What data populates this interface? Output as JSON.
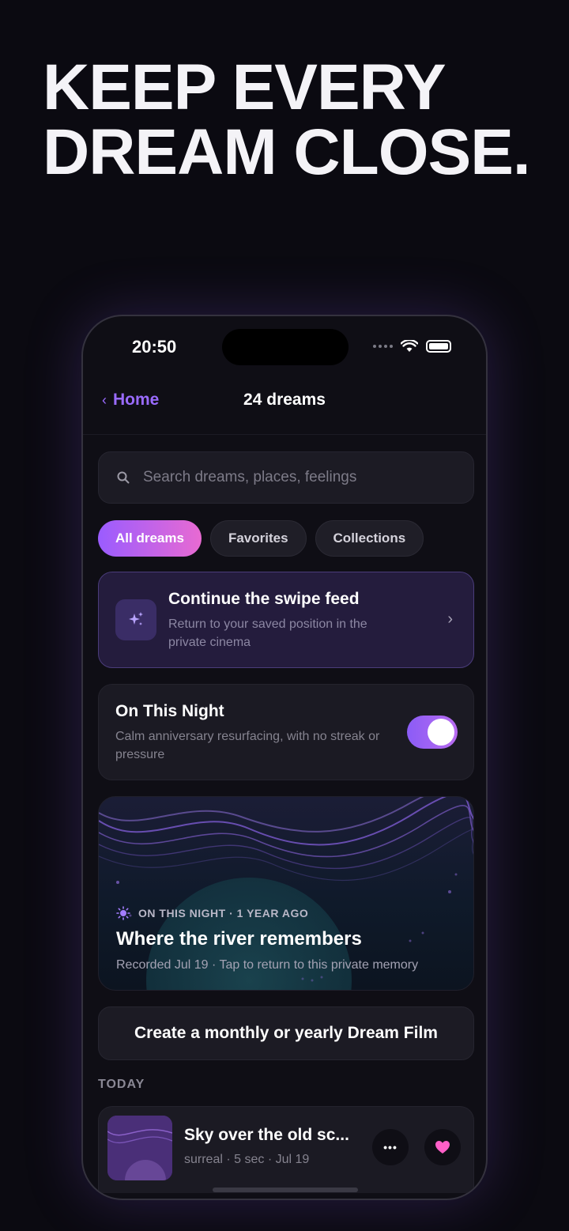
{
  "headline": {
    "line1": "KEEP EVERY",
    "line2": "DREAM CLOSE."
  },
  "status_bar": {
    "time": "20:50"
  },
  "navbar": {
    "back_label": "Home",
    "title": "24 dreams"
  },
  "search": {
    "placeholder": "Search dreams, places, feelings",
    "value": ""
  },
  "filters": [
    {
      "label": "All dreams",
      "active": true
    },
    {
      "label": "Favorites",
      "active": false
    },
    {
      "label": "Collections",
      "active": false
    }
  ],
  "continue_card": {
    "title": "Continue the swipe feed",
    "subtitle": "Return to your saved position in the private cinema"
  },
  "on_this_night": {
    "title": "On This Night",
    "subtitle": "Calm anniversary resurfacing, with no streak or pressure",
    "enabled": true
  },
  "memory_card": {
    "label": "ON THIS NIGHT · 1 YEAR AGO",
    "title": "Where the river remembers",
    "subtitle": "Recorded Jul 19 · Tap to return to this private memory"
  },
  "film_button": {
    "label": "Create a monthly or yearly Dream Film"
  },
  "today_section": {
    "heading": "TODAY",
    "items": [
      {
        "title": "Sky over the old sc...",
        "meta": "surreal · 5 sec · Jul 19",
        "favorite": true
      }
    ]
  },
  "colors": {
    "accent": "#9a6bff",
    "gradient_start": "#9a5cff",
    "gradient_end": "#e86ad2",
    "heart": "#ff5fc8"
  }
}
